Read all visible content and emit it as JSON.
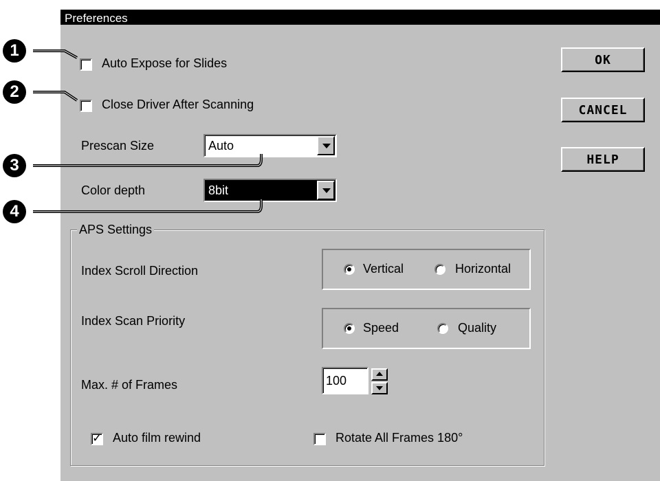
{
  "window": {
    "title": "Preferences"
  },
  "options": {
    "auto_expose": {
      "label": "Auto Expose for Slides",
      "checked": false
    },
    "close_driver": {
      "label": "Close Driver After Scanning",
      "checked": false
    }
  },
  "prescan": {
    "label": "Prescan Size",
    "value": "Auto"
  },
  "color_depth": {
    "label": "Color depth",
    "value": "8bit"
  },
  "buttons": {
    "ok": "OK",
    "cancel": "CANCEL",
    "help": "HELP"
  },
  "aps": {
    "title": "APS Settings",
    "scroll_direction": {
      "label": "Index Scroll Direction",
      "options": [
        "Vertical",
        "Horizontal"
      ],
      "selected": "Vertical"
    },
    "scan_priority": {
      "label": "Index Scan Priority",
      "options": [
        "Speed",
        "Quality"
      ],
      "selected": "Speed"
    },
    "max_frames": {
      "label": "Max. # of Frames",
      "value": "100"
    },
    "auto_rewind": {
      "label": "Auto film rewind",
      "checked": true
    },
    "rotate": {
      "label": "Rotate All Frames 180°",
      "checked": false
    }
  },
  "callouts": [
    "1",
    "2",
    "3",
    "4"
  ],
  "colors": {
    "dialog_bg": "#c0c0c0",
    "titlebar": "#000000",
    "selection": "#000000"
  }
}
